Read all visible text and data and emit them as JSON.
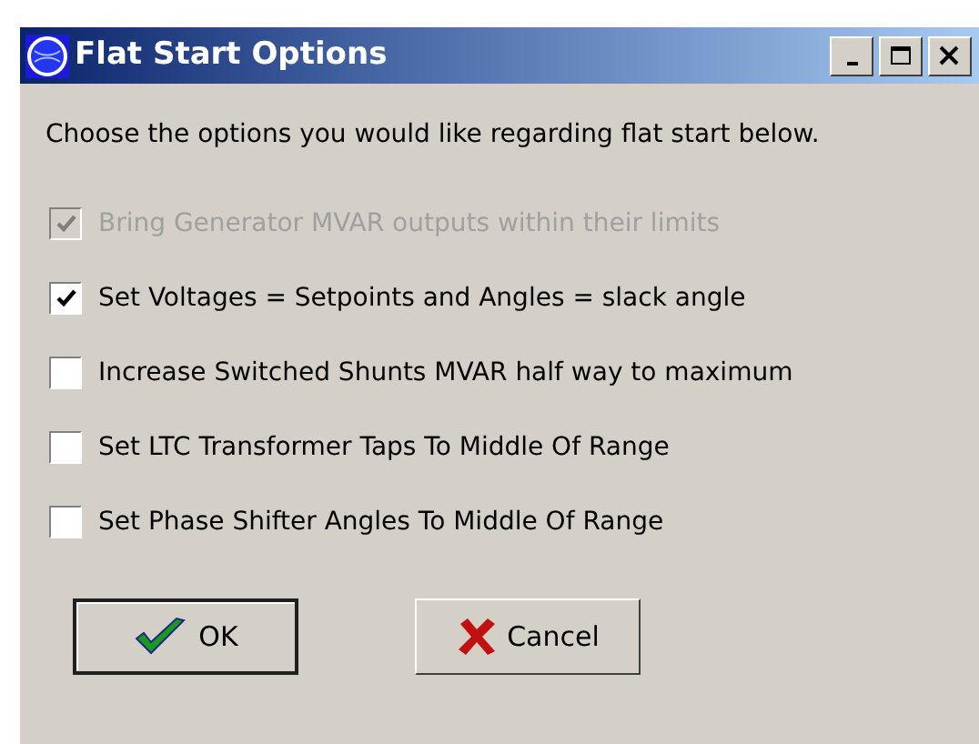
{
  "window": {
    "title": "Flat Start Options"
  },
  "title_buttons": [
    {
      "kind": "minimize"
    },
    {
      "kind": "maximize"
    },
    {
      "kind": "close"
    }
  ],
  "instruction": "Choose the options you would like regarding flat start below.",
  "options": [
    {
      "label": "Bring Generator MVAR outputs within their limits",
      "checked": true,
      "disabled": true
    },
    {
      "label": "Set Voltages = Setpoints and Angles = slack angle",
      "checked": true,
      "disabled": false
    },
    {
      "label": "Increase Switched Shunts MVAR half way to maximum",
      "checked": false,
      "disabled": false
    },
    {
      "label": "Set LTC Transformer Taps To Middle Of Range",
      "checked": false,
      "disabled": false
    },
    {
      "label": "Set Phase Shifter Angles To Middle Of Range",
      "checked": false,
      "disabled": false
    }
  ],
  "buttons": [
    {
      "kind": "ok",
      "label": "OK",
      "default": true
    },
    {
      "kind": "cancel",
      "label": "Cancel",
      "default": false
    }
  ]
}
